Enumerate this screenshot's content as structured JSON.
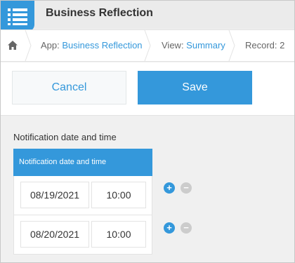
{
  "header": {
    "title": "Business Reflection",
    "app_icon": "list-icon"
  },
  "breadcrumb": {
    "home_icon": "home-icon",
    "app_prefix": "App: ",
    "app_name": "Business Reflection",
    "view_prefix": "View: ",
    "view_name": "Summary",
    "record_label": "Record: 2"
  },
  "actions": {
    "cancel_label": "Cancel",
    "save_label": "Save"
  },
  "field": {
    "label": "Notification date and time",
    "table_header": "Notification date and time",
    "rows": [
      {
        "date": "08/19/2021",
        "time": "10:00",
        "add_symbol": "+",
        "remove_symbol": "−"
      },
      {
        "date": "08/20/2021",
        "time": "10:00",
        "add_symbol": "+",
        "remove_symbol": "−"
      }
    ]
  },
  "colors": {
    "accent": "#3498db",
    "header_bg": "#ebebeb",
    "body_bg": "#f0f0f0"
  }
}
